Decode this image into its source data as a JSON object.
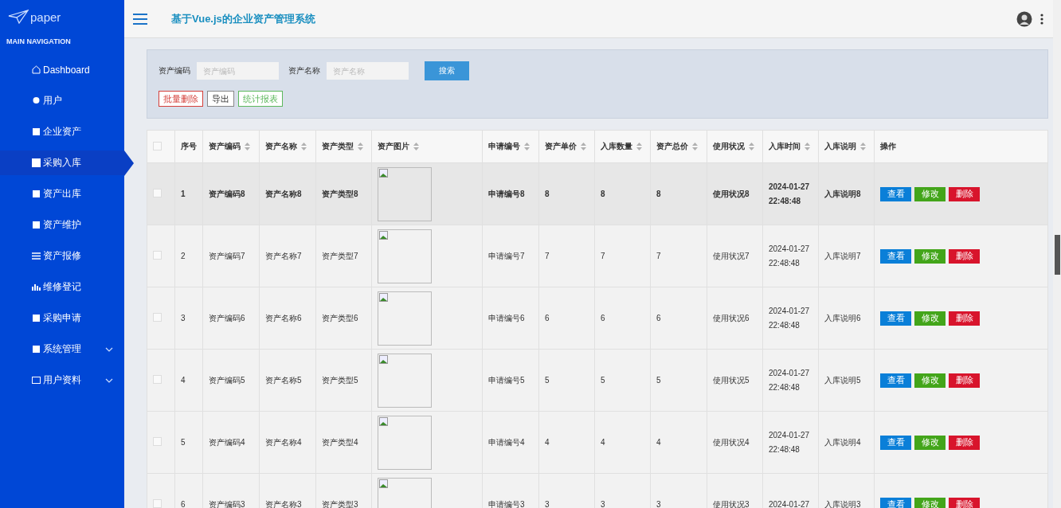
{
  "sidebar": {
    "logo": "paper",
    "section": "MAIN NAVIGATION",
    "items": [
      {
        "label": "Dashboard",
        "selected": false
      },
      {
        "label": "用户",
        "selected": false
      },
      {
        "label": "企业资产",
        "selected": false
      },
      {
        "label": "采购入库",
        "selected": true
      },
      {
        "label": "资产出库",
        "selected": false
      },
      {
        "label": "资产维护",
        "selected": false
      },
      {
        "label": "资产报修",
        "selected": false
      },
      {
        "label": "维修登记",
        "selected": false
      },
      {
        "label": "采购申请",
        "selected": false
      },
      {
        "label": "系统管理",
        "selected": false,
        "expanded": false
      },
      {
        "label": "用户资料",
        "selected": false,
        "expanded": false
      }
    ]
  },
  "header": {
    "title": "基于Vue.js的企业资产管理系统"
  },
  "search": {
    "fields": [
      {
        "label": "资产编码",
        "placeholder": "资产编码"
      },
      {
        "label": "资产名称",
        "placeholder": "资产名称"
      }
    ],
    "button": "搜索",
    "actions": [
      {
        "label": "批量删除",
        "kind": "danger"
      },
      {
        "label": "导出",
        "kind": "plain"
      },
      {
        "label": "统计报表",
        "kind": "success"
      }
    ]
  },
  "table": {
    "all_checked": false,
    "columns": [
      {
        "label": "序号",
        "sortable": false
      },
      {
        "label": "资产编码",
        "sortable": true
      },
      {
        "label": "资产名称",
        "sortable": true
      },
      {
        "label": "资产类型",
        "sortable": true
      },
      {
        "label": "资产图片",
        "sortable": true
      },
      {
        "label": "申请编号",
        "sortable": true
      },
      {
        "label": "资产单价",
        "sortable": true
      },
      {
        "label": "入库数量",
        "sortable": true
      },
      {
        "label": "资产总价",
        "sortable": true
      },
      {
        "label": "使用状况",
        "sortable": true
      },
      {
        "label": "入库时间",
        "sortable": true
      },
      {
        "label": "入库说明",
        "sortable": true
      },
      {
        "label": "操作",
        "sortable": false
      }
    ],
    "rows": [
      {
        "checked": false,
        "highlighted": true,
        "cells": [
          {
            "text": "1"
          },
          {
            "text": "资产编码8"
          },
          {
            "text": "资产名称8"
          },
          {
            "text": "资产类型8"
          },
          {
            "kind": "image"
          },
          {
            "text": "申请编号8"
          },
          {
            "text": "8"
          },
          {
            "text": "8"
          },
          {
            "text": "8"
          },
          {
            "text": "使用状况8"
          },
          {
            "text": "2024-01-27 22:48:48"
          },
          {
            "text": "入库说明8"
          }
        ],
        "actions": [
          {
            "label": "查看",
            "kind": "view"
          },
          {
            "label": "修改",
            "kind": "edit"
          },
          {
            "label": "删除",
            "kind": "delete"
          }
        ]
      },
      {
        "checked": false,
        "highlighted": false,
        "cells": [
          {
            "text": "2"
          },
          {
            "text": "资产编码7"
          },
          {
            "text": "资产名称7"
          },
          {
            "text": "资产类型7"
          },
          {
            "kind": "image"
          },
          {
            "text": "申请编号7"
          },
          {
            "text": "7"
          },
          {
            "text": "7"
          },
          {
            "text": "7"
          },
          {
            "text": "使用状况7"
          },
          {
            "text": "2024-01-27 22:48:48"
          },
          {
            "text": "入库说明7"
          }
        ],
        "actions": [
          {
            "label": "查看",
            "kind": "view"
          },
          {
            "label": "修改",
            "kind": "edit"
          },
          {
            "label": "删除",
            "kind": "delete"
          }
        ]
      },
      {
        "checked": false,
        "highlighted": false,
        "cells": [
          {
            "text": "3"
          },
          {
            "text": "资产编码6"
          },
          {
            "text": "资产名称6"
          },
          {
            "text": "资产类型6"
          },
          {
            "kind": "image"
          },
          {
            "text": "申请编号6"
          },
          {
            "text": "6"
          },
          {
            "text": "6"
          },
          {
            "text": "6"
          },
          {
            "text": "使用状况6"
          },
          {
            "text": "2024-01-27 22:48:48"
          },
          {
            "text": "入库说明6"
          }
        ],
        "actions": [
          {
            "label": "查看",
            "kind": "view"
          },
          {
            "label": "修改",
            "kind": "edit"
          },
          {
            "label": "删除",
            "kind": "delete"
          }
        ]
      },
      {
        "checked": false,
        "highlighted": false,
        "cells": [
          {
            "text": "4"
          },
          {
            "text": "资产编码5"
          },
          {
            "text": "资产名称5"
          },
          {
            "text": "资产类型5"
          },
          {
            "kind": "image"
          },
          {
            "text": "申请编号5"
          },
          {
            "text": "5"
          },
          {
            "text": "5"
          },
          {
            "text": "5"
          },
          {
            "text": "使用状况5"
          },
          {
            "text": "2024-01-27 22:48:48"
          },
          {
            "text": "入库说明5"
          }
        ],
        "actions": [
          {
            "label": "查看",
            "kind": "view"
          },
          {
            "label": "修改",
            "kind": "edit"
          },
          {
            "label": "删除",
            "kind": "delete"
          }
        ]
      },
      {
        "checked": false,
        "highlighted": false,
        "cells": [
          {
            "text": "5"
          },
          {
            "text": "资产编码4"
          },
          {
            "text": "资产名称4"
          },
          {
            "text": "资产类型4"
          },
          {
            "kind": "image"
          },
          {
            "text": "申请编号4"
          },
          {
            "text": "4"
          },
          {
            "text": "4"
          },
          {
            "text": "4"
          },
          {
            "text": "使用状况4"
          },
          {
            "text": "2024-01-27 22:48:48"
          },
          {
            "text": "入库说明4"
          }
        ],
        "actions": [
          {
            "label": "查看",
            "kind": "view"
          },
          {
            "label": "修改",
            "kind": "edit"
          },
          {
            "label": "删除",
            "kind": "delete"
          }
        ]
      },
      {
        "checked": false,
        "highlighted": false,
        "cells": [
          {
            "text": "6"
          },
          {
            "text": "资产编码3"
          },
          {
            "text": "资产名称3"
          },
          {
            "text": "资产类型3"
          },
          {
            "kind": "image"
          },
          {
            "text": "申请编号3"
          },
          {
            "text": "3"
          },
          {
            "text": "3"
          },
          {
            "text": "3"
          },
          {
            "text": "使用状况3"
          },
          {
            "text": "2024-01-27"
          },
          {
            "text": "入库说明3"
          }
        ],
        "actions": [
          {
            "label": "查看",
            "kind": "view"
          },
          {
            "label": "修改",
            "kind": "edit"
          },
          {
            "label": "删除",
            "kind": "delete"
          }
        ]
      }
    ]
  }
}
